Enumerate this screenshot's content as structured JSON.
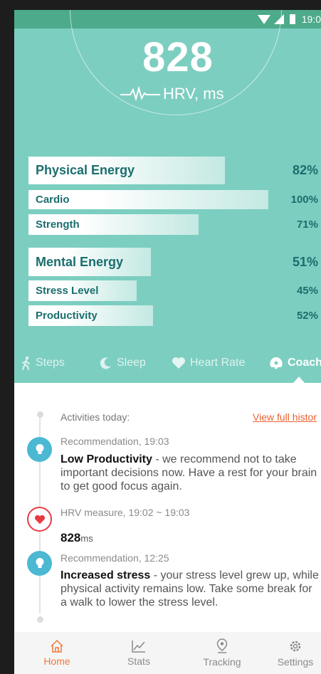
{
  "status": {
    "time": "19:0"
  },
  "hrv": {
    "value": "828",
    "label": "HRV, ms"
  },
  "energy": [
    {
      "label": "Physical Energy",
      "pct": "82%",
      "level": 82,
      "kind": "big"
    },
    {
      "label": "Cardio",
      "pct": "100%",
      "level": 100,
      "kind": "small"
    },
    {
      "label": "Strength",
      "pct": "71%",
      "level": 71,
      "kind": "small"
    },
    {
      "label": "Mental Energy",
      "pct": "51%",
      "level": 51,
      "kind": "big"
    },
    {
      "label": "Stress Level",
      "pct": "45%",
      "level": 45,
      "kind": "small"
    },
    {
      "label": "Productivity",
      "pct": "52%",
      "level": 52,
      "kind": "small"
    }
  ],
  "tabs": [
    {
      "label": "Steps",
      "icon": "walking-icon"
    },
    {
      "label": "Sleep",
      "icon": "moon-icon"
    },
    {
      "label": "Heart Rate",
      "icon": "heart-icon"
    },
    {
      "label": "Coach",
      "icon": "coach-icon",
      "active": true
    }
  ],
  "timeline": {
    "header": "Activities today:",
    "view_history": "View full histor",
    "items": [
      {
        "type": "recommendation",
        "meta": "Recommendation, 19:03",
        "title": "Low Productivity",
        "text": " - we recommend not to take important decisions now. Have a rest for your brain to get good focus again."
      },
      {
        "type": "hrv",
        "meta": "HRV measure, 19:02 ~ 19:03",
        "value": "828",
        "unit": "ms"
      },
      {
        "type": "recommendation",
        "meta": "Recommendation, 12:25",
        "title": "Increased stress",
        "text": " - your stress level grew up, while physical activity remains low. Take some break for a walk to lower the stress level."
      }
    ]
  },
  "nav": [
    {
      "label": "Home",
      "icon": "home-icon",
      "active": true
    },
    {
      "label": "Stats",
      "icon": "chart-icon"
    },
    {
      "label": "Tracking",
      "icon": "location-pin-icon"
    },
    {
      "label": "Settings",
      "icon": "gear-icon"
    }
  ],
  "colors": {
    "accent": "#f0783c",
    "teal": "#7ccec0",
    "status": "#4daa8a",
    "bar_text": "#1a6e6e"
  }
}
